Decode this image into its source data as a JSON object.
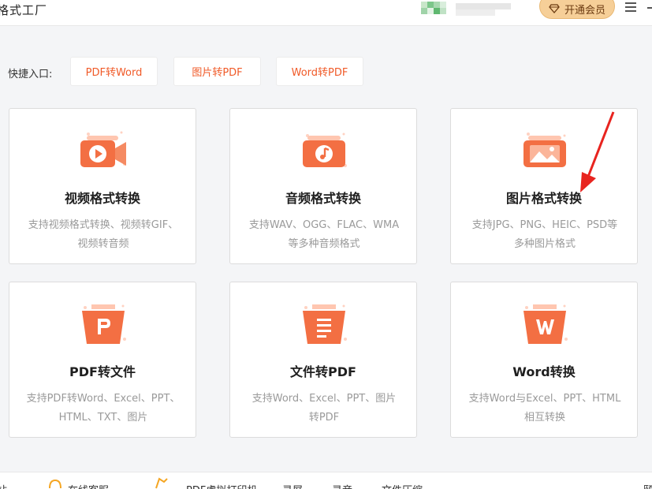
{
  "app": {
    "title": "格式工厂"
  },
  "header": {
    "vip_label": "开通会员"
  },
  "quick_entry": {
    "label": "快捷入口:",
    "buttons": [
      "PDF转Word",
      "图片转PDF",
      "Word转PDF"
    ]
  },
  "cards": [
    {
      "title": "视频格式转换",
      "desc": [
        "支持视频格式转换、视频转GIF、",
        "视频转音频"
      ],
      "icon": "video-camera-icon"
    },
    {
      "title": "音频格式转换",
      "desc": [
        "支持WAV、OGG、FLAC、WMA",
        "等多种音频格式"
      ],
      "icon": "music-note-icon"
    },
    {
      "title": "图片格式转换",
      "desc": [
        "支持JPG、PNG、HEIC、PSD等",
        "多种图片格式"
      ],
      "icon": "image-icon"
    },
    {
      "title": "PDF转文件",
      "desc": [
        "支持PDF转Word、Excel、PPT、",
        "HTML、TXT、图片"
      ],
      "icon": "ppt-letter-p-icon"
    },
    {
      "title": "文件转PDF",
      "desc": [
        "支持Word、Excel、PPT、图片",
        "转PDF"
      ],
      "icon": "document-lines-icon"
    },
    {
      "title": "Word转换",
      "desc": [
        "支持Word与Excel、PPT、HTML",
        "相互转换"
      ],
      "icon": "word-letter-w-icon"
    }
  ],
  "bottom": {
    "items": [
      "站",
      "在线客服",
      "PDF虚拟打印机",
      "录屏",
      "录音",
      "文件压缩",
      "颐"
    ]
  },
  "colors": {
    "accent": "#f05a28",
    "vip": "#f6cf98"
  }
}
